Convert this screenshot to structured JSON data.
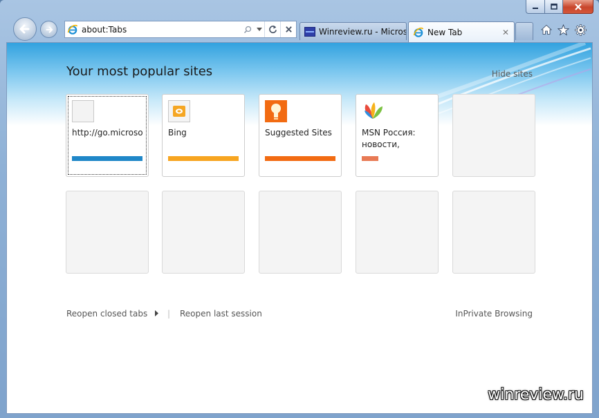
{
  "browser": {
    "address_value": "about:Tabs",
    "tabs": [
      {
        "title": "Winreview.ru - Micros",
        "active": false
      },
      {
        "title": "New Tab",
        "active": true
      }
    ],
    "tab_close_glyph": "✕"
  },
  "page": {
    "heading": "Your most popular sites",
    "hide_sites": "Hide sites",
    "tiles": [
      {
        "label": "http://go.microso",
        "icon": "blank-page-icon",
        "bar_color": "#1f87c8",
        "bar_fraction": 1.0
      },
      {
        "label": "Bing",
        "icon": "bing-icon",
        "bar_color": "#f7a520",
        "bar_fraction": 1.0
      },
      {
        "label": "Suggested Sites",
        "icon": "suggested-sites-icon",
        "bar_color": "#f26b12",
        "bar_fraction": 1.0
      },
      {
        "label": "MSN Россия: новости, почта...",
        "icon": "msn-butterfly-icon",
        "bar_color": "#e87a55",
        "bar_fraction": 0.24
      }
    ],
    "footer": {
      "reopen_closed_tabs": "Reopen closed tabs",
      "separator": "|",
      "reopen_last_session": "Reopen last session",
      "inprivate": "InPrivate Browsing"
    }
  },
  "watermark": "winreview.ru",
  "colors": {
    "ie_blue": "#1b8fd6",
    "bing_orange": "#f5a623",
    "suggested_orange": "#f26b12"
  }
}
